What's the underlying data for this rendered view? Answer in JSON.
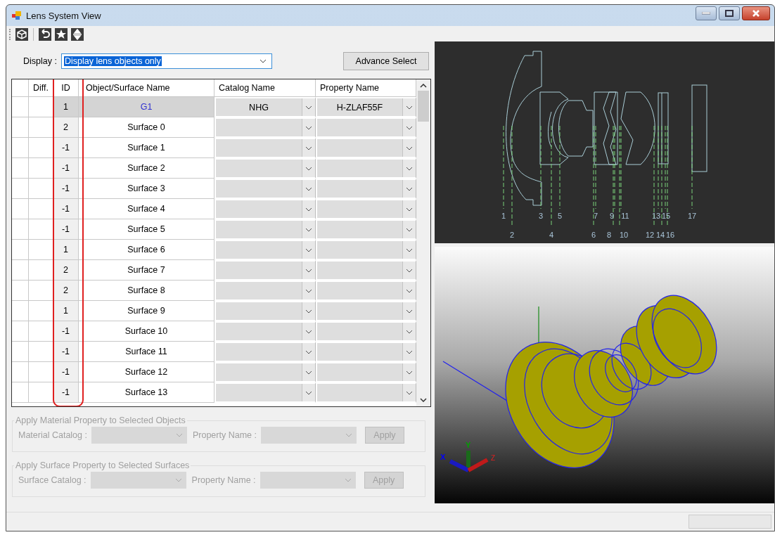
{
  "window": {
    "title": "Lens System View"
  },
  "toolbar": [
    {
      "kind": "cube"
    },
    {
      "kind": "undo"
    },
    {
      "kind": "star"
    },
    {
      "kind": "updown"
    }
  ],
  "display": {
    "label": "Display :",
    "value": "Display lens objects only"
  },
  "advance_button": "Advance Select",
  "table": {
    "columns": [
      "Diff.",
      "ID",
      "Object/Surface Name",
      "Catalog Name",
      "Property Name"
    ],
    "id_column_highlighted": true,
    "rows": [
      {
        "id": "1",
        "name": "G1",
        "catalog": "NHG",
        "property": "H-ZLAF55F",
        "selected": true
      },
      {
        "id": "2",
        "name": "Surface 0",
        "selected": false
      },
      {
        "id": "-1",
        "name": "Surface 1",
        "selected": false
      },
      {
        "id": "-1",
        "name": "Surface 2",
        "selected": false
      },
      {
        "id": "-1",
        "name": "Surface 3",
        "selected": false
      },
      {
        "id": "-1",
        "name": "Surface 4",
        "selected": false
      },
      {
        "id": "-1",
        "name": "Surface 5",
        "selected": false
      },
      {
        "id": "1",
        "name": "Surface 6",
        "selected": false
      },
      {
        "id": "2",
        "name": "Surface 7",
        "selected": false
      },
      {
        "id": "2",
        "name": "Surface 8",
        "selected": false
      },
      {
        "id": "1",
        "name": "Surface 9",
        "selected": false
      },
      {
        "id": "-1",
        "name": "Surface 10",
        "selected": false
      },
      {
        "id": "-1",
        "name": "Surface 11",
        "selected": false
      },
      {
        "id": "-1",
        "name": "Surface 12",
        "selected": false
      },
      {
        "id": "-1",
        "name": "Surface 13",
        "selected": false
      }
    ]
  },
  "groups": [
    {
      "title": "Apply Material Property to Selected Objects",
      "catalog_label": "Material Catalog :",
      "property_label": "Property Name :",
      "button": "Apply",
      "disabled": true
    },
    {
      "title": "Apply Surface Property to Selected Surfaces",
      "catalog_label": "Surface Catalog :",
      "property_label": "Property Name :",
      "button": "Apply",
      "disabled": true
    }
  ],
  "section_view": {
    "surface_labels": [
      "1",
      "3",
      "5",
      "7",
      "9",
      "11",
      "13",
      "15",
      "17",
      "2",
      "4",
      "6",
      "8",
      "10",
      "12",
      "14",
      "16"
    ]
  },
  "view_3d": {
    "axes": [
      "X",
      "Y",
      "Z"
    ]
  }
}
